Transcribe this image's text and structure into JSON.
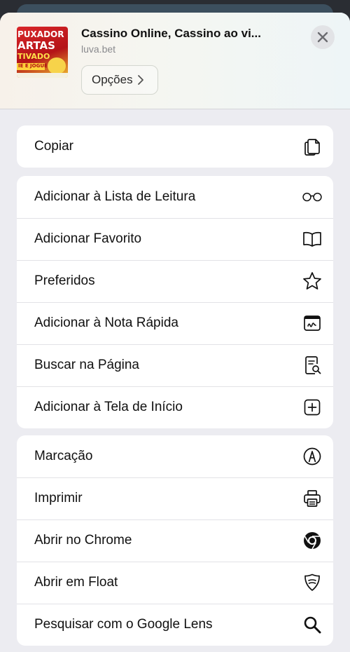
{
  "header": {
    "title": "Cassino Online, Cassino ao vi...",
    "domain": "luva.bet",
    "options_label": "Opções",
    "thumbnail_lines": [
      "PUXADOR",
      "ARTAS",
      "TIVADO",
      "IE E JOGUE"
    ]
  },
  "groups": [
    {
      "items": [
        {
          "label": "Copiar",
          "icon": "copy-icon"
        }
      ]
    },
    {
      "items": [
        {
          "label": "Adicionar à Lista de Leitura",
          "icon": "glasses-icon"
        },
        {
          "label": "Adicionar Favorito",
          "icon": "book-icon"
        },
        {
          "label": "Preferidos",
          "icon": "star-icon"
        },
        {
          "label": "Adicionar à Nota Rápida",
          "icon": "quick-note-icon"
        },
        {
          "label": "Buscar na Página",
          "icon": "find-in-page-icon"
        },
        {
          "label": "Adicionar à Tela de Início",
          "icon": "add-square-icon"
        }
      ]
    },
    {
      "items": [
        {
          "label": "Marcação",
          "icon": "markup-icon"
        },
        {
          "label": "Imprimir",
          "icon": "printer-icon"
        },
        {
          "label": "Abrir no Chrome",
          "icon": "chrome-icon"
        },
        {
          "label": "Abrir em Float",
          "icon": "float-shield-icon"
        },
        {
          "label": "Pesquisar com o Google Lens",
          "icon": "search-icon"
        }
      ]
    }
  ]
}
